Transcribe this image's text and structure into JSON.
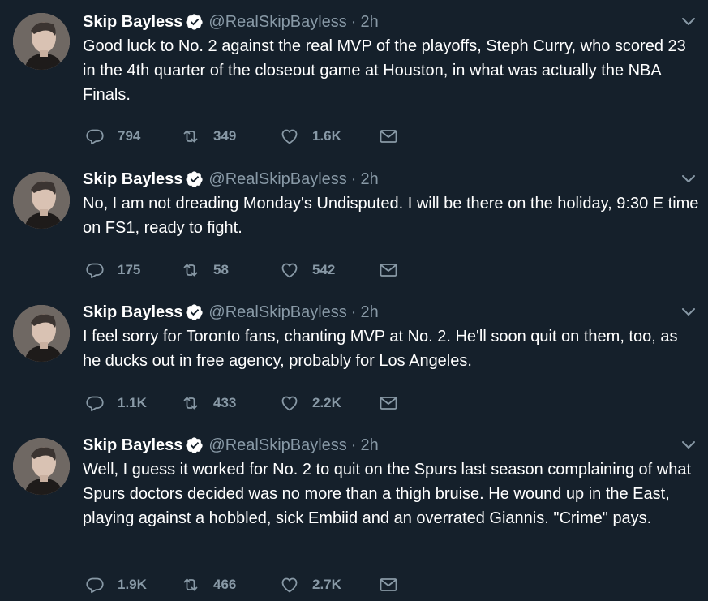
{
  "tweets": [
    {
      "name": "Skip Bayless",
      "handle": "@RealSkipBayless",
      "separator": "·",
      "time": "2h",
      "text": "Good luck to No. 2 against the real MVP of the playoffs, Steph Curry, who scored 23 in the 4th quarter of the closeout game at Houston, in what was actually the NBA Finals.",
      "replies": "794",
      "retweets": "349",
      "likes": "1.6K"
    },
    {
      "name": "Skip Bayless",
      "handle": "@RealSkipBayless",
      "separator": "·",
      "time": "2h",
      "text": "No, I am not dreading Monday's Undisputed. I will be there on the holiday, 9:30 E time on FS1, ready to fight.",
      "replies": "175",
      "retweets": "58",
      "likes": "542"
    },
    {
      "name": "Skip Bayless",
      "handle": "@RealSkipBayless",
      "separator": "·",
      "time": "2h",
      "text": "I feel sorry for Toronto fans, chanting MVP at No. 2. He'll soon quit on them, too, as he ducks out in free agency, probably for Los Angeles.",
      "replies": "1.1K",
      "retweets": "433",
      "likes": "2.2K"
    },
    {
      "name": "Skip Bayless",
      "handle": "@RealSkipBayless",
      "separator": "·",
      "time": "2h",
      "text": "Well, I guess it worked for No. 2 to quit on the Spurs last season complaining of what Spurs doctors decided was no more than a thigh bruise. He wound up in the East, playing against a hobbled, sick Embiid and an overrated Giannis. \"Crime\" pays.",
      "replies": "1.9K",
      "retweets": "466",
      "likes": "2.7K"
    }
  ],
  "icons": {
    "reply": "reply-icon",
    "retweet": "retweet-icon",
    "like": "heart-icon",
    "dm": "envelope-icon",
    "verified": "verified-badge-icon",
    "more": "chevron-down-icon"
  },
  "colors": {
    "background": "#15202b",
    "divider": "#38444d",
    "secondary_text": "#8899a6",
    "verified_badge": "#ffffff"
  }
}
